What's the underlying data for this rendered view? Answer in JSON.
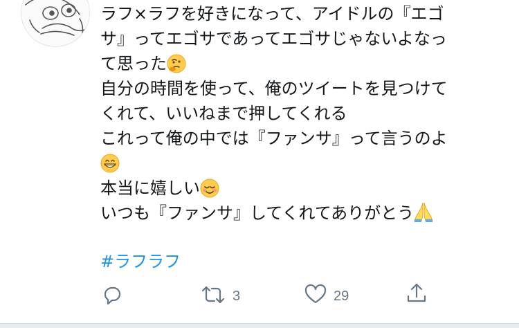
{
  "tweet": {
    "lines": [
      "ラフ×ラフを好きになって、アイドルの『エゴ",
      "サ』ってエゴサであってエゴサじゃないよなっ",
      "て思った",
      "自分の時間を使って、俺のツイートを見つけて",
      "くれて、いいねまで押してくれる",
      "これって俺の中では『ファンサ』って言うのよ",
      "",
      "本当に嬉しい",
      "いつも『ファンサ』してくれてありがとう"
    ],
    "emojis": [
      "thinking-face",
      "grinning-face",
      "smiling-face",
      "folded-hands"
    ],
    "hashtag": "#ラフラフ"
  },
  "actions": {
    "reply_icon": "reply-icon",
    "retweet_icon": "retweet-icon",
    "retweet_count": "3",
    "like_icon": "heart-icon",
    "like_count": "29",
    "share_icon": "share-icon"
  },
  "colors": {
    "text": "#14171a",
    "link": "#1b95e0",
    "muted": "#657786",
    "divider": "#e6ecf0"
  }
}
